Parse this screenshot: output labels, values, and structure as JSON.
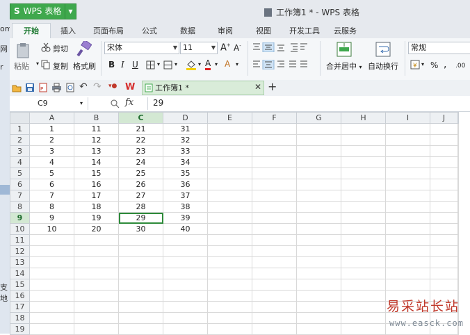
{
  "app": {
    "name": "WPS 表格",
    "window_title": "工作簿1 * - WPS 表格"
  },
  "left_strip": {
    "fragments": [
      "om",
      "网",
      "r",
      "支地"
    ]
  },
  "menu_tabs": [
    "开始",
    "插入",
    "页面布局",
    "公式",
    "数据",
    "审阅",
    "视图",
    "开发工具",
    "云服务"
  ],
  "active_tab": "开始",
  "ribbon": {
    "cut": "剪切",
    "copy": "复制",
    "paste": "粘贴",
    "format_painter": "格式刷",
    "font_name": "宋体",
    "font_size": "11",
    "bold": "B",
    "italic": "I",
    "underline": "U",
    "merge_center": "合并居中",
    "wrap_text": "自动换行",
    "number_format": "常规",
    "percent": "%",
    "comma": ",",
    "decimal": ".00"
  },
  "quick_access": {
    "doc_tab": "工作簿1 *"
  },
  "formula_bar": {
    "name_box": "C9",
    "fx": "fx",
    "value": "29"
  },
  "sheet": {
    "selected_cell": "C9",
    "columns": [
      "A",
      "B",
      "C",
      "D",
      "E",
      "F",
      "G",
      "H",
      "I",
      "J"
    ],
    "rows": [
      [
        "1",
        "11",
        "21",
        "31"
      ],
      [
        "2",
        "12",
        "22",
        "32"
      ],
      [
        "3",
        "13",
        "23",
        "33"
      ],
      [
        "4",
        "14",
        "24",
        "34"
      ],
      [
        "5",
        "15",
        "25",
        "35"
      ],
      [
        "6",
        "16",
        "26",
        "36"
      ],
      [
        "7",
        "17",
        "27",
        "37"
      ],
      [
        "8",
        "18",
        "28",
        "38"
      ],
      [
        "9",
        "19",
        "29",
        "39"
      ],
      [
        "10",
        "20",
        "30",
        "40"
      ],
      [],
      [],
      [],
      [],
      [],
      [],
      [],
      [],
      []
    ]
  },
  "watermark": {
    "title": "易采站长站",
    "url": "www.easck.com"
  },
  "colors": {
    "accent": "#3fa84d",
    "selection": "#2e8b3a",
    "watermark_red": "#c0392b"
  }
}
